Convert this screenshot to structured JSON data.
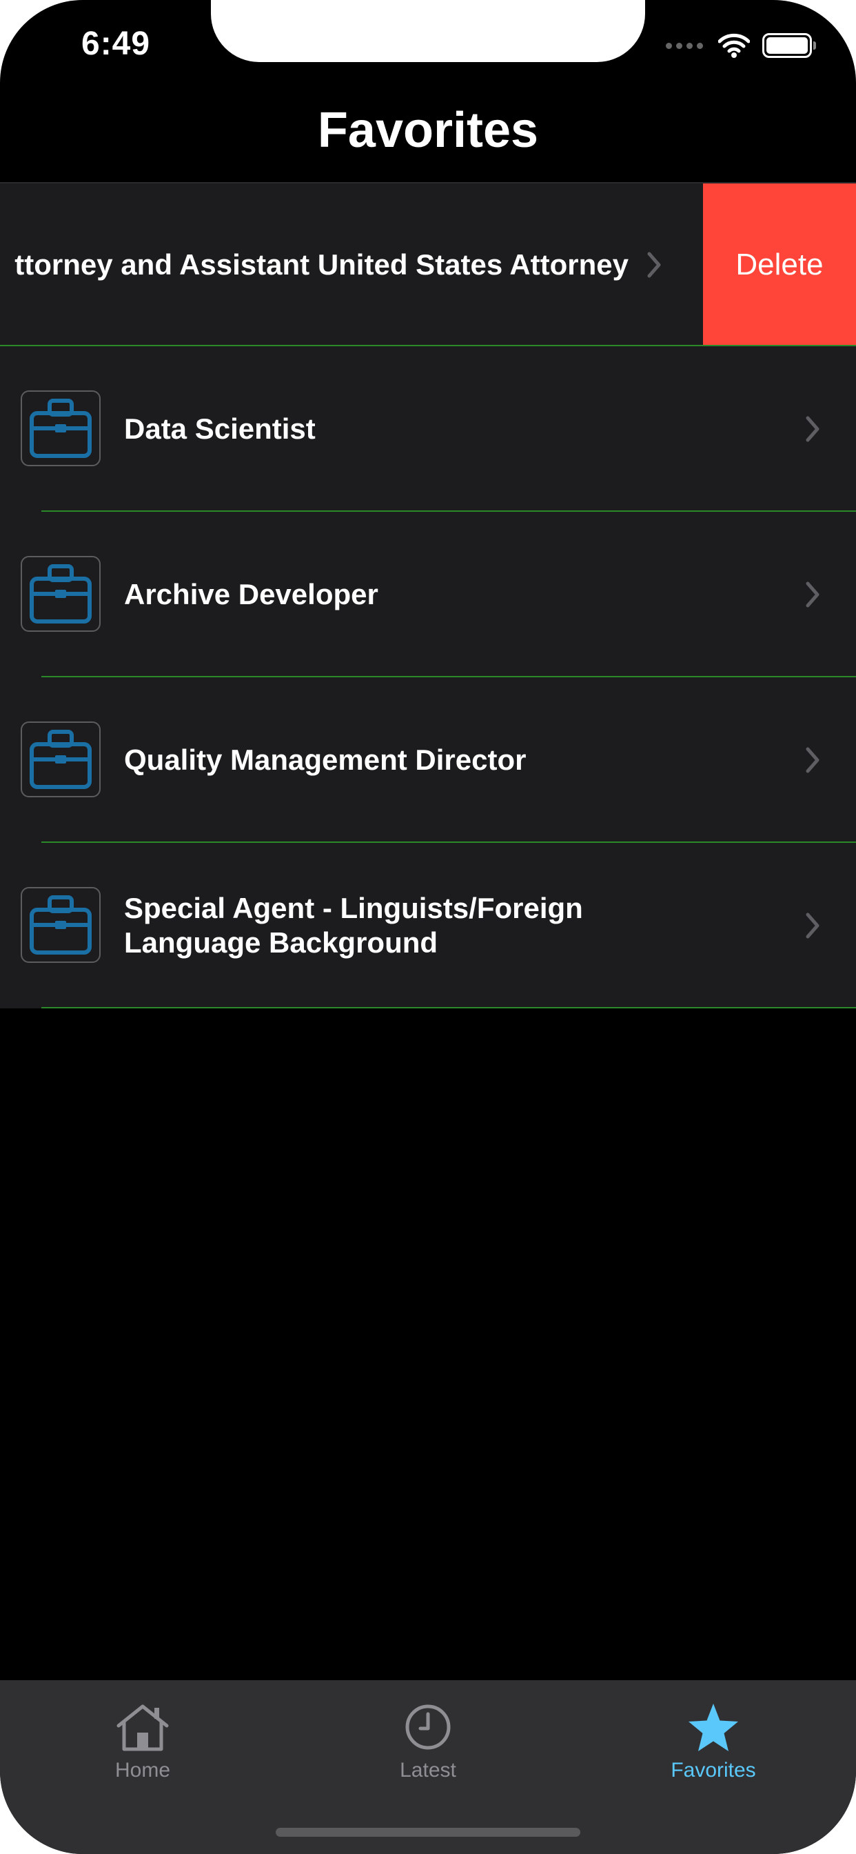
{
  "status_bar": {
    "time": "6:49"
  },
  "nav": {
    "title": "Favorites"
  },
  "swiped_row": {
    "label": "ttorney and Assistant United States Attorney",
    "delete_label": "Delete"
  },
  "rows": [
    {
      "title": "Data Scientist"
    },
    {
      "title": "Archive Developer"
    },
    {
      "title": "Quality Management Director"
    },
    {
      "title": "Special Agent - Linguists/Foreign Language Background"
    }
  ],
  "tabs": [
    {
      "label": "Home",
      "icon": "house-icon"
    },
    {
      "label": "Latest",
      "icon": "clock-icon"
    },
    {
      "label": "Favorites",
      "icon": "star-icon",
      "selected": true
    }
  ],
  "colors": {
    "accent": "#5ac8fa",
    "delete": "#ff453a",
    "separator": "#2a8a2a",
    "row_background": "#1c1c1e",
    "briefcase": "#1a6fa5"
  }
}
